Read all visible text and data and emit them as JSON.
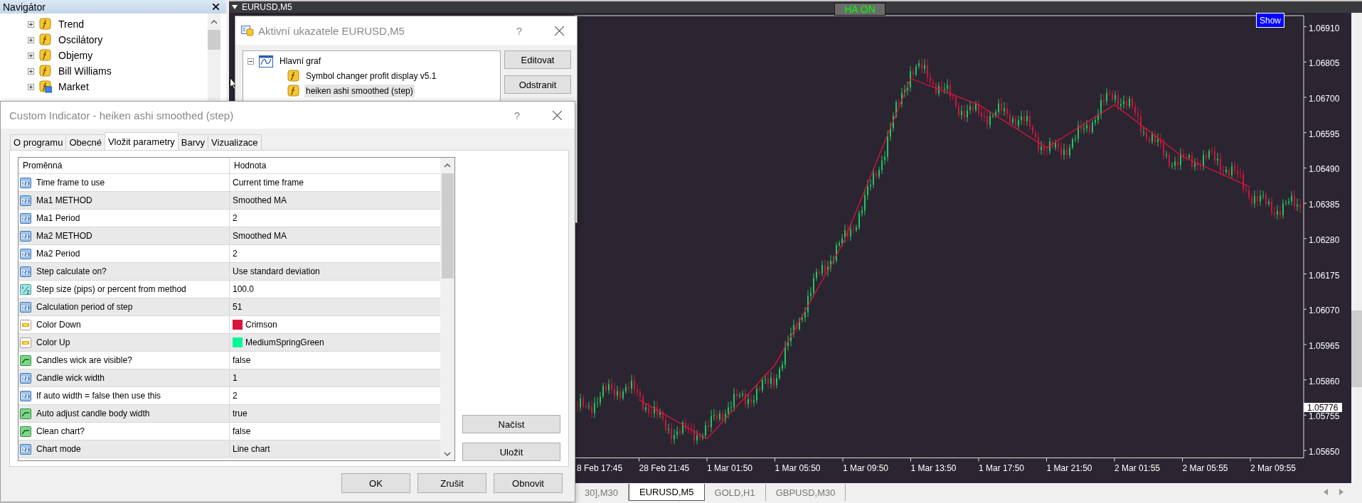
{
  "navigator": {
    "title": "Navigátor",
    "items": [
      {
        "label": "Trend",
        "kind": "folder",
        "expanded": false
      },
      {
        "label": "Oscilátory",
        "kind": "folder",
        "expanded": false
      },
      {
        "label": "Objemy",
        "kind": "folder",
        "expanded": false
      },
      {
        "label": "Bill Williams",
        "kind": "folder",
        "expanded": false
      },
      {
        "label": "Market",
        "kind": "market",
        "expanded": false
      }
    ]
  },
  "chart_window": {
    "title": "EURUSD,M5",
    "ha_button": "HA ON",
    "show_button": "Show",
    "current_price": "1.05776",
    "chart_data": {
      "type": "line",
      "categories": [
        "8 Feb 17:45",
        "28 Feb 21:45",
        "1 Mar 01:50",
        "1 Mar 05:50",
        "1 Mar 09:50",
        "1 Mar 13:50",
        "1 Mar 17:50",
        "1 Mar 21:50",
        "2 Mar 01:55",
        "2 Mar 05:55",
        "2 Mar 09:55"
      ],
      "series": [
        {
          "color": "#dc143c",
          "values": [
            null,
            1.05801,
            1.05685,
            1.05904,
            1.06265,
            1.06756,
            1.06678,
            1.0655,
            1.06678,
            1.06524,
            1.06433
          ]
        }
      ],
      "ylim": [
        1.05628,
        1.06943
      ],
      "yticks": [
        {
          "value": 1.0691,
          "label": "1.06910"
        },
        {
          "value": 1.06805,
          "label": "1.06805"
        },
        {
          "value": 1.067,
          "label": "1.06700"
        },
        {
          "value": 1.06595,
          "label": "1.06595"
        },
        {
          "value": 1.0649,
          "label": "1.06490"
        },
        {
          "value": 1.06385,
          "label": "1.06385"
        },
        {
          "value": 1.0628,
          "label": "1.06280"
        },
        {
          "value": 1.06175,
          "label": "1.06175"
        },
        {
          "value": 1.0607,
          "label": "1.06070"
        },
        {
          "value": 1.05965,
          "label": "1.05965"
        },
        {
          "value": 1.0586,
          "label": "1.05860"
        },
        {
          "value": 1.05755,
          "label": "1.05755"
        },
        {
          "value": 1.0565,
          "label": "1.05650"
        }
      ]
    }
  },
  "chart_tabs": [
    {
      "label": "30],M30",
      "selected": false
    },
    {
      "label": "EURUSD,M5",
      "selected": true
    },
    {
      "label": "GOLD,H1",
      "selected": false
    },
    {
      "label": "GBPUSD,M30",
      "selected": false
    }
  ],
  "active_indicators_dialog": {
    "title": "Aktivní ukazatele EURUSD,M5",
    "help": "?",
    "tree": [
      {
        "label": "Hlavní graf",
        "expanded": true,
        "selected": false,
        "children": [
          {
            "label": "Symbol changer profit display v5.1",
            "selected": false
          },
          {
            "label": "heiken ashi smoothed (step)",
            "selected": true
          }
        ]
      }
    ],
    "buttons": [
      "Editovat",
      "Odstranit"
    ]
  },
  "indicator_dialog": {
    "title": "Custom Indicator - heiken ashi smoothed (step)",
    "help": "?",
    "tabs": [
      {
        "label": "O programu",
        "selected": false
      },
      {
        "label": "Obecné",
        "selected": false
      },
      {
        "label": "Vložit parametry",
        "selected": true
      },
      {
        "label": "Barvy",
        "selected": false
      },
      {
        "label": "Vizualizace",
        "selected": false
      }
    ],
    "columns": [
      "Proměnná",
      "Hodnota"
    ],
    "rows": [
      {
        "kind": "int",
        "name": "Time frame to use",
        "value": "Current time frame"
      },
      {
        "kind": "int",
        "name": "Ma1 METHOD",
        "value": "Smoothed MA"
      },
      {
        "kind": "int",
        "name": "Ma1 Period",
        "value": "2"
      },
      {
        "kind": "int",
        "name": "Ma2 METHOD",
        "value": "Smoothed MA"
      },
      {
        "kind": "int",
        "name": "Ma2 Period",
        "value": "2"
      },
      {
        "kind": "int",
        "name": "Step calculate on?",
        "value": "Use standard deviation"
      },
      {
        "kind": "double",
        "name": "Step size (pips) or percent from method",
        "value": "100.0"
      },
      {
        "kind": "int",
        "name": "Calculation period of step",
        "value": "51"
      },
      {
        "kind": "color",
        "name": "Color Down",
        "value": "Crimson",
        "color": "#dc143c"
      },
      {
        "kind": "color",
        "name": "Color Up",
        "value": "MediumSpringGreen",
        "color": "#00fa9a"
      },
      {
        "kind": "bool",
        "name": "Candles wick are visible?",
        "value": "false"
      },
      {
        "kind": "int",
        "name": "Candle wick width",
        "value": "1"
      },
      {
        "kind": "int",
        "name": "If auto width = false then use this",
        "value": "2"
      },
      {
        "kind": "bool",
        "name": "Auto adjust candle body width",
        "value": "true"
      },
      {
        "kind": "bool",
        "name": "Clean chart?",
        "value": "false"
      },
      {
        "kind": "int",
        "name": "Chart mode",
        "value": "Line chart"
      }
    ],
    "side_buttons": [
      "Načíst",
      "Uložit"
    ],
    "buttons": [
      "OK",
      "Zrušit",
      "Obnovit"
    ]
  }
}
